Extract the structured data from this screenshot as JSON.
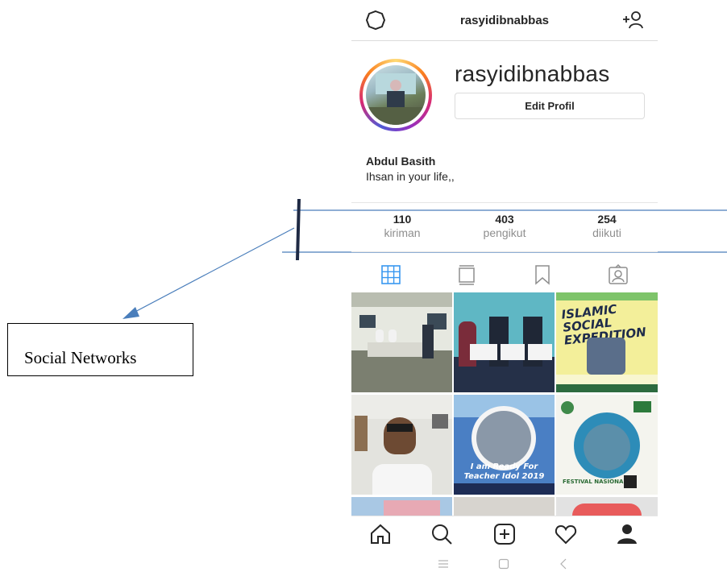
{
  "header": {
    "username": "rasyidibnabbas"
  },
  "profile": {
    "handle": "rasyidibnabbas",
    "edit_label": "Edit Profil",
    "full_name": "Abdul Basith",
    "bio": "Ihsan in your life,,"
  },
  "stats": [
    {
      "value": "110",
      "label": "kiriman"
    },
    {
      "value": "403",
      "label": "pengikut"
    },
    {
      "value": "254",
      "label": "diikuti"
    }
  ],
  "tabs": [
    "grid-icon",
    "feed-icon",
    "bookmark-icon",
    "tagged-icon"
  ],
  "posts": {
    "p3_title": "ISLAMIC SOCIAL EXPEDITION",
    "p5_caption_1": "I am Ready For",
    "p5_caption_2": "Teacher Idol 2019",
    "p6_caption": "FESTIVAL NASIONAL"
  },
  "bottom_nav": [
    "home-icon",
    "search-icon",
    "add-post-icon",
    "heart-icon",
    "profile-icon"
  ],
  "system_nav": [
    "menu-icon",
    "home-square-icon",
    "back-icon"
  ],
  "annotation": {
    "label": "Social Networks"
  },
  "colors": {
    "accent": "#3897f0",
    "annotation_line": "#4a7ebb"
  }
}
